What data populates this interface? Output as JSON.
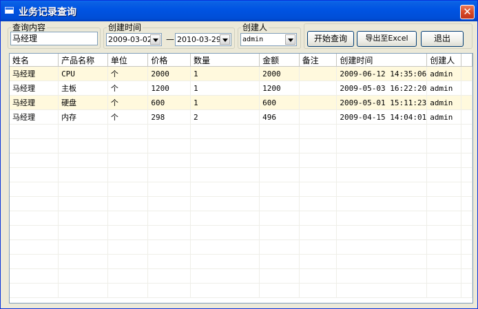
{
  "window": {
    "title": "业务记录查询",
    "close_glyph": "✕"
  },
  "query": {
    "content_label": "查询内容",
    "content_value": "马经理",
    "time_label": "创建时间",
    "date_from": "2009-03-02",
    "date_sep": "—",
    "date_to": "2010-03-29",
    "creator_label": "创建人",
    "creator_value": "admin"
  },
  "buttons": {
    "start": "开始查询",
    "export": "导出至Excel",
    "exit": "退出"
  },
  "table": {
    "columns": [
      "姓名",
      "产品名称",
      "单位",
      "价格",
      "数量",
      "金额",
      "备注",
      "创建时间",
      "创建人"
    ],
    "rows": [
      [
        "马经理",
        "CPU",
        "个",
        "2000",
        "1",
        "2000",
        "",
        "2009-06-12 14:35:06",
        "admin"
      ],
      [
        "马经理",
        "主板",
        "个",
        "1200",
        "1",
        "1200",
        "",
        "2009-05-03 16:22:20",
        "admin"
      ],
      [
        "马经理",
        "硬盘",
        "个",
        "600",
        "1",
        "600",
        "",
        "2009-05-01 15:11:23",
        "admin"
      ],
      [
        "马经理",
        "内存",
        "个",
        "298",
        "2",
        "496",
        "",
        "2009-04-15 14:04:01",
        "admin"
      ]
    ]
  },
  "colors": {
    "highlight_row": "#fff9dd",
    "title_bar": "#0054e3",
    "close_button": "#d84a25"
  }
}
